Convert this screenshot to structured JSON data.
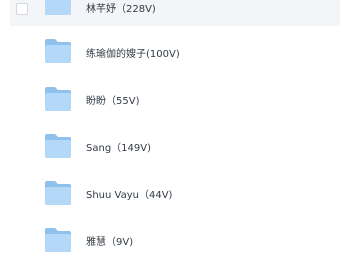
{
  "files": [
    {
      "name": "林芊妤（228V)",
      "icon": "folder-icon"
    },
    {
      "name": "练瑜伽的嫂子(100V)",
      "icon": "folder-icon"
    },
    {
      "name": "盼盼（55V)",
      "icon": "folder-icon"
    },
    {
      "name": "Sang（149V)",
      "icon": "folder-icon"
    },
    {
      "name": "Shuu Vayu（44V)",
      "icon": "folder-icon"
    },
    {
      "name": "雅慧（9V)",
      "icon": "folder-icon"
    }
  ],
  "colors": {
    "folder_back": "#8fc1ec",
    "folder_front": "#b4d9f8",
    "hover_row": "#f3f5f8",
    "text": "#333b45"
  }
}
